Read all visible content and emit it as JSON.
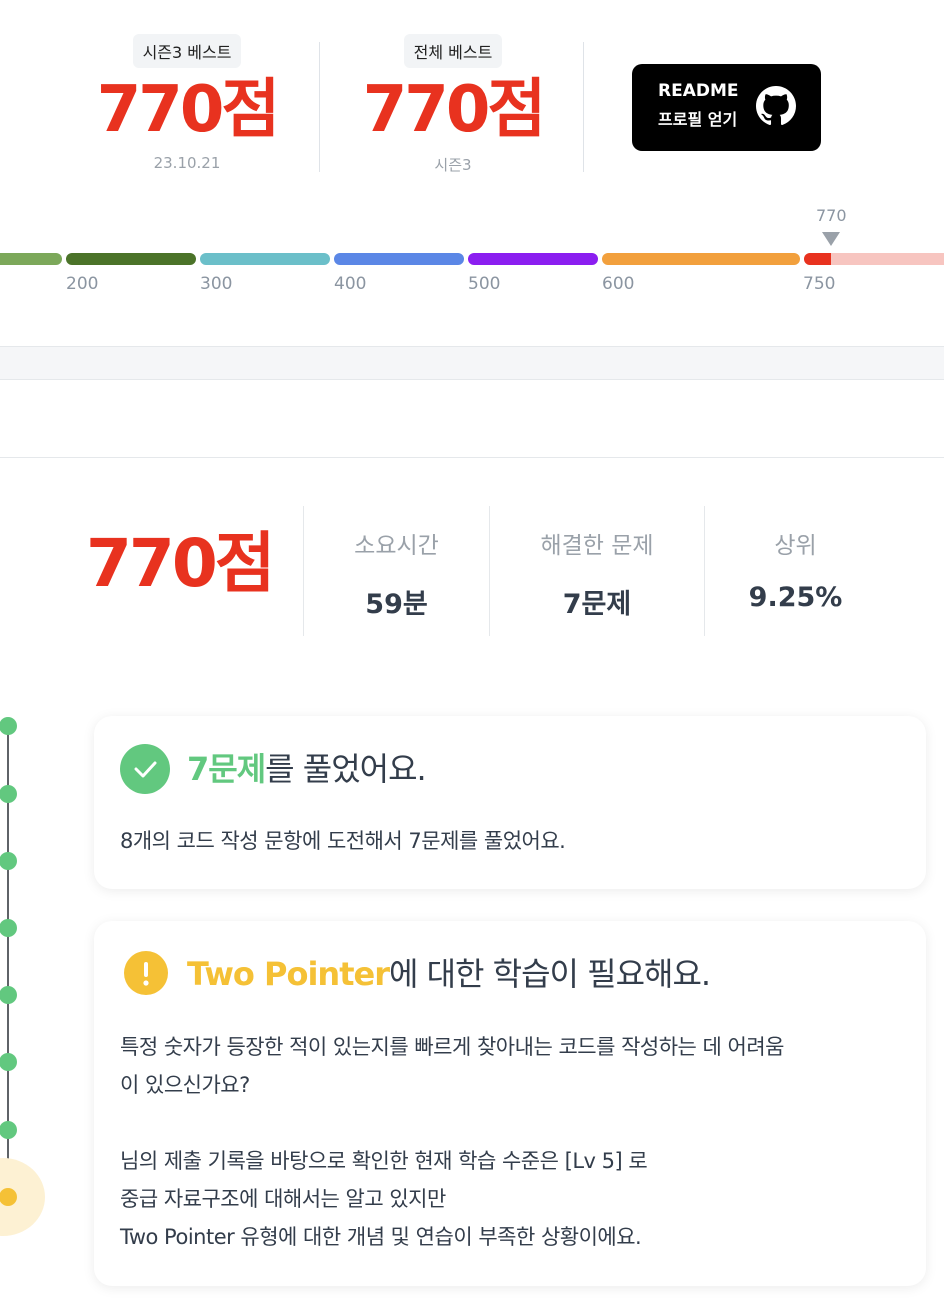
{
  "best": {
    "season": {
      "tag": "시즌3 베스트",
      "score": "770점",
      "sub": "23.10.21"
    },
    "overall": {
      "tag": "전체 베스트",
      "score": "770점",
      "sub": "시즌3"
    }
  },
  "readme": {
    "line1": "README",
    "line2": "프로필 얻기",
    "icon": "github-icon"
  },
  "tier_bar": {
    "marker_value": "770",
    "labels": [
      "200",
      "300",
      "400",
      "500",
      "600",
      "750"
    ],
    "colors": [
      "#7ca85a",
      "#4b7329",
      "#6bbfc9",
      "#5b87e6",
      "#8b1ef0",
      "#f2a03d",
      "#e8321f",
      "#f7c5c0"
    ],
    "progress_value": 770
  },
  "result": {
    "score": "770점",
    "stats": [
      {
        "label": "소요시간",
        "value": "59분"
      },
      {
        "label": "해결한 문제",
        "value": "7문제"
      },
      {
        "label": "상위",
        "value": "9.25%"
      }
    ]
  },
  "card_solved": {
    "icon": "check-icon",
    "title_highlight": "7문제",
    "title_rest": "를 풀었어요.",
    "body": "8개의 코드 작성 문항에 도전해서 7문제를 풀었어요."
  },
  "card_weak": {
    "icon": "exclamation-icon",
    "title_highlight": "Two Pointer",
    "title_rest": "에 대한 학습이 필요해요.",
    "body1": "특정 숫자가 등장한 적이 있는지를 빠르게 찾아내는 코드를 작성하는 데 어려움",
    "body2": "이 있으신가요?",
    "body3": "님의 제출 기록을 바탕으로 확인한 현재 학습 수준은 [Lv 5] 로",
    "body4": "중급 자료구조에 대해서는 알고 있지만",
    "body5": "Two Pointer 유형에 대한 개념 및 연습이 부족한 상황이에요."
  },
  "colors": {
    "score_red": "#e8321f",
    "success_green": "#62c87f",
    "warning_yellow": "#f5c136"
  }
}
